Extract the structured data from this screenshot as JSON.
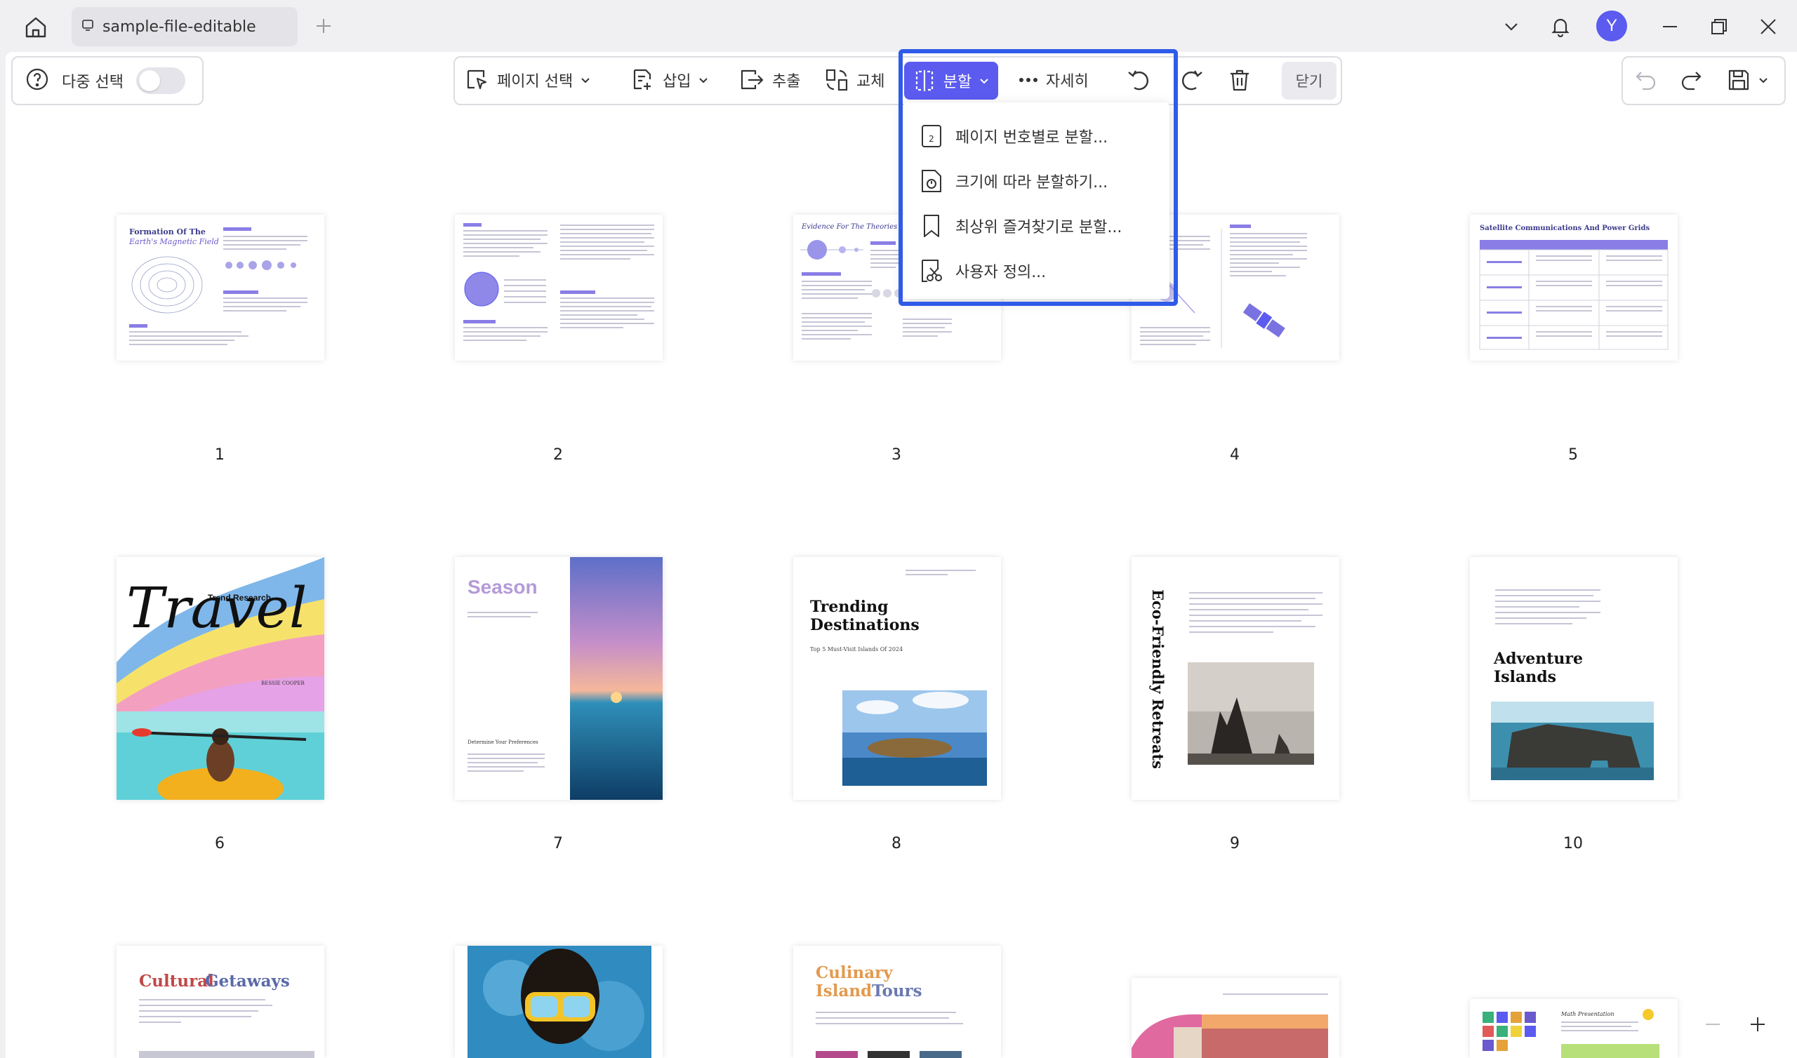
{
  "tab": {
    "title": "sample-file-editable"
  },
  "user": {
    "initial": "Y"
  },
  "multi_select": {
    "label": "다중 선택",
    "enabled": false
  },
  "toolbar": {
    "page_select": "페이지 선택",
    "insert": "삽입",
    "extract": "추출",
    "replace": "교체",
    "split": "분할",
    "more": "자세히",
    "close": "닫기"
  },
  "split_menu": [
    {
      "label": "페이지 번호별로 분할..."
    },
    {
      "label": "크기에 따라 분할하기..."
    },
    {
      "label": "최상위 즐겨찾기로 분할..."
    },
    {
      "label": "사용자 정의..."
    }
  ],
  "pages": [
    {
      "number": "1",
      "heading": "Formation Of The",
      "heading2": "Earth's Magnetic Field"
    },
    {
      "number": "2"
    },
    {
      "number": "3",
      "heading": "Evidence For The Theories"
    },
    {
      "number": "4"
    },
    {
      "number": "5",
      "heading": "Satellite Communications And Power Grids"
    },
    {
      "number": "6",
      "heading": "Travel",
      "sub": "Trend Research",
      "author": "BESSIE COOPER"
    },
    {
      "number": "7",
      "heading": "Season",
      "sub": "Determine Your Preferences"
    },
    {
      "number": "8",
      "heading": "Trending Destinations",
      "sub": "Top 5 Must-Visit Islands Of 2024"
    },
    {
      "number": "9",
      "heading": "Eco-Friendly Retreats"
    },
    {
      "number": "10",
      "heading": "Adventure Islands"
    },
    {
      "number": "",
      "heading": "Cultural Getaways"
    },
    {
      "number": ""
    },
    {
      "number": "",
      "heading": "Culinary Island Tours"
    },
    {
      "number": ""
    },
    {
      "number": "",
      "heading": "Math Presentation"
    }
  ],
  "colors": {
    "accent": "#5b5bf0",
    "highlight": "#2f5be8"
  }
}
